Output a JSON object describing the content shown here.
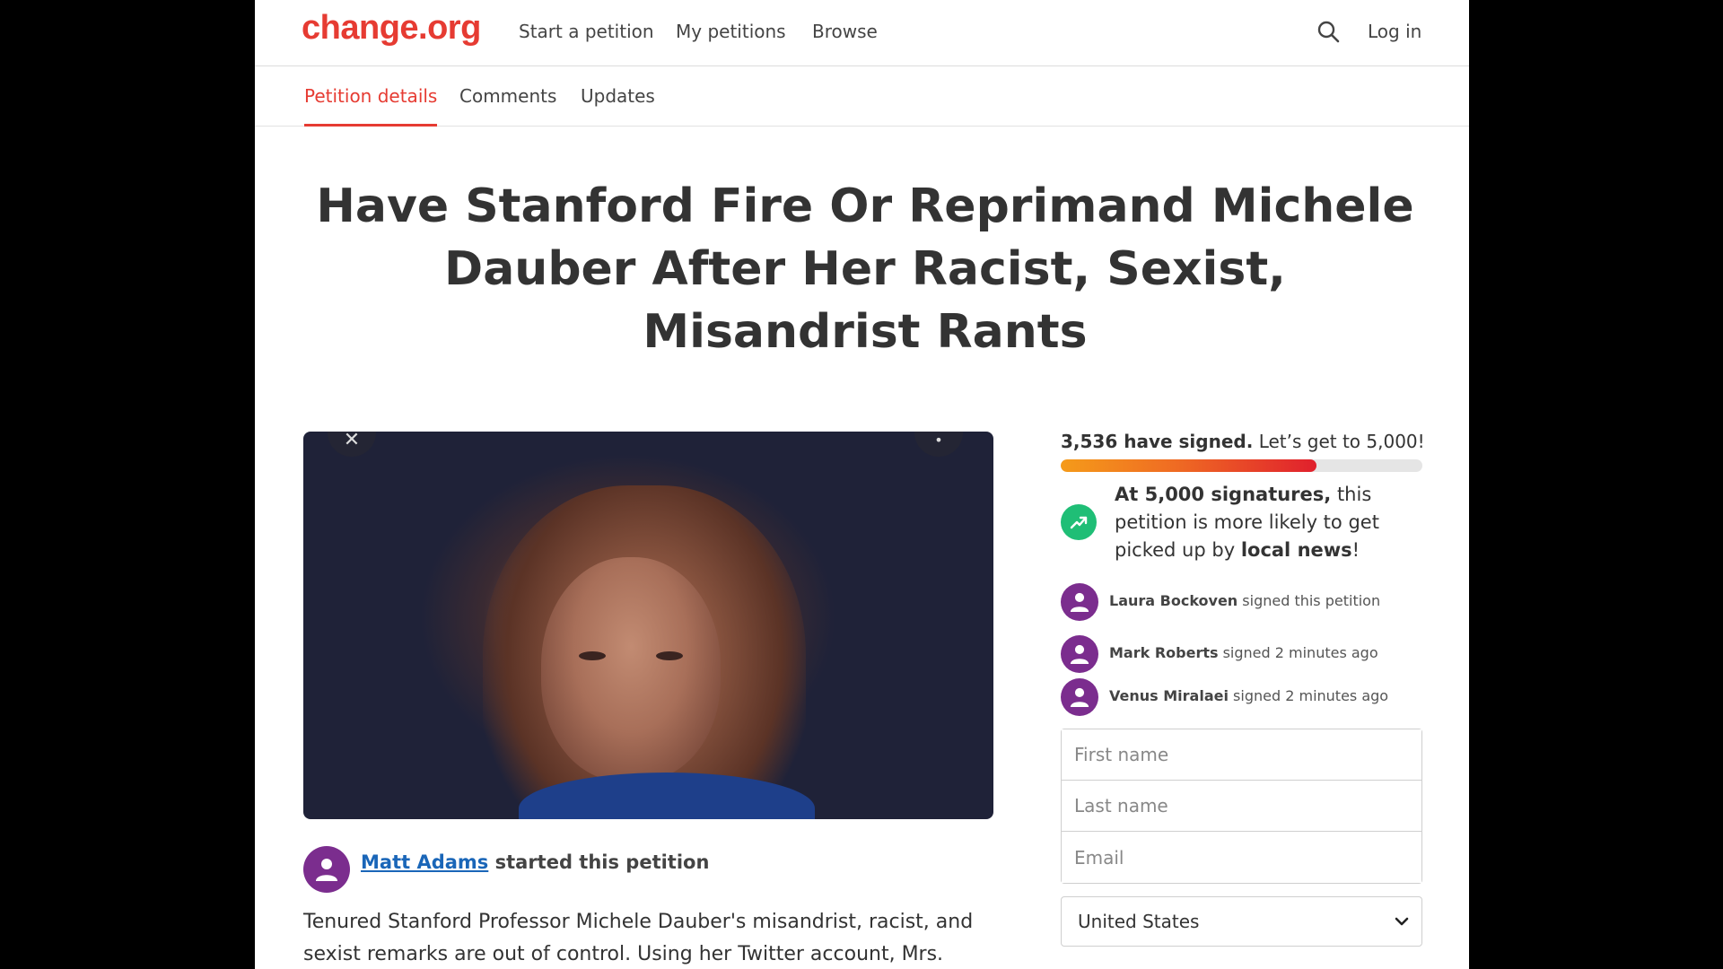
{
  "brand": {
    "logo": "change.org",
    "accent": "#e63b32"
  },
  "nav": {
    "items": [
      "Start a petition",
      "My petitions",
      "Browse"
    ],
    "search_icon": "search-icon",
    "login": "Log in"
  },
  "tabs": [
    "Petition details",
    "Comments",
    "Updates"
  ],
  "active_tab": "Petition details",
  "title": "Have Stanford Fire Or Reprimand Michele Dauber After Her Racist, Sexist, Misandrist Rants",
  "hero": {
    "controls": [
      "close-icon",
      "more-icon"
    ]
  },
  "starter": {
    "name": "Matt Adams",
    "suffix": "started this petition"
  },
  "body_text": "Tenured Stanford Professor Michele Dauber's misandrist, racist, and sexist remarks are out of control. Using her Twitter account, Mrs.",
  "progress": {
    "signed_count": "3,536 have signed.",
    "goal_text": "Let’s get to 5,000!",
    "signed": 3536,
    "goal": 5000
  },
  "milestone": {
    "bold_prefix": "At 5,000 signatures,",
    "middle": "this petition is more likely to get picked up by",
    "bold_suffix": "local news",
    "end": "!"
  },
  "recent_signers": [
    {
      "name": "Laura Bockoven",
      "action": "signed this petition"
    },
    {
      "name": "Mark Roberts",
      "action": "signed 2 minutes ago"
    },
    {
      "name": "Venus Miralaei",
      "action": "signed 2 minutes ago"
    }
  ],
  "form": {
    "first_name_placeholder": "First name",
    "last_name_placeholder": "Last name",
    "email_placeholder": "Email",
    "country": "United States"
  }
}
